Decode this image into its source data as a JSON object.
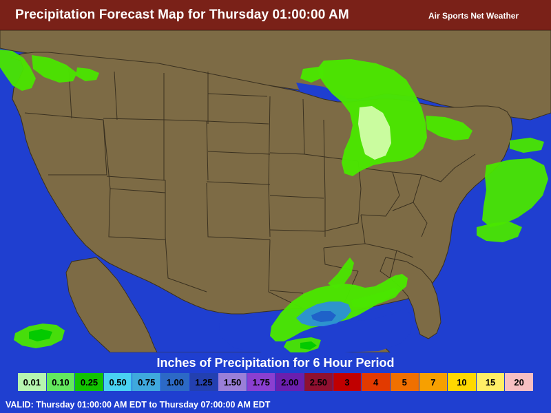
{
  "header": {
    "title": "Precipitation Forecast Map for Thursday 01:00:00 AM",
    "brand": "Air Sports Net Weather",
    "bar_color": "#7a2118"
  },
  "map": {
    "name": "precipitation-forecast-map",
    "region": "Continental United States",
    "ocean_color": "#1f3fd0",
    "land_color": "#7d6b45",
    "border_color": "#3a3120",
    "precip_colors": [
      "#4ae600",
      "#00c800",
      "#00a0ff",
      "#7fd7ff"
    ]
  },
  "legend": {
    "title": "Inches of Precipitation for 6 Hour Period",
    "steps": [
      {
        "label": "0.01",
        "color": "#b6f5b0",
        "text_color": "#000000"
      },
      {
        "label": "0.10",
        "color": "#63e85e",
        "text_color": "#000000"
      },
      {
        "label": "0.25",
        "color": "#12c400",
        "text_color": "#000000"
      },
      {
        "label": "0.50",
        "color": "#49d2f2",
        "text_color": "#000000"
      },
      {
        "label": "0.75",
        "color": "#3fa9dd",
        "text_color": "#000000"
      },
      {
        "label": "1.00",
        "color": "#2c69c6",
        "text_color": "#000000"
      },
      {
        "label": "1.25",
        "color": "#2340b0",
        "text_color": "#000000"
      },
      {
        "label": "1.50",
        "color": "#9a7fd8",
        "text_color": "#000000"
      },
      {
        "label": "1.75",
        "color": "#8a3fd0",
        "text_color": "#000000"
      },
      {
        "label": "2.00",
        "color": "#6a1fae",
        "text_color": "#000000"
      },
      {
        "label": "2.50",
        "color": "#8f1030",
        "text_color": "#000000"
      },
      {
        "label": "3",
        "color": "#c00000",
        "text_color": "#000000"
      },
      {
        "label": "4",
        "color": "#e23a00",
        "text_color": "#000000"
      },
      {
        "label": "5",
        "color": "#f07000",
        "text_color": "#000000"
      },
      {
        "label": "7",
        "color": "#f7a000",
        "text_color": "#000000"
      },
      {
        "label": "10",
        "color": "#ffd800",
        "text_color": "#000000"
      },
      {
        "label": "15",
        "color": "#ffee66",
        "text_color": "#000000"
      },
      {
        "label": "20",
        "color": "#f6bfc2",
        "text_color": "#000000"
      }
    ]
  },
  "footer": {
    "valid_text": "VALID: Thursday 01:00:00 AM EDT to Thursday 07:00:00 AM EDT"
  }
}
